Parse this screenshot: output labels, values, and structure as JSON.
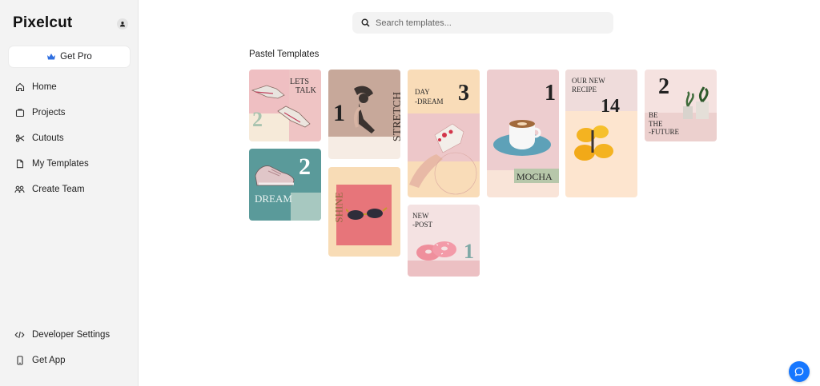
{
  "app": {
    "name": "Pixelcut"
  },
  "sidebar": {
    "get_pro": "Get Pro",
    "items": [
      {
        "label": "Home",
        "icon": "home-icon"
      },
      {
        "label": "Projects",
        "icon": "folder-icon"
      },
      {
        "label": "Cutouts",
        "icon": "scissors-icon"
      },
      {
        "label": "My Templates",
        "icon": "document-icon"
      },
      {
        "label": "Create Team",
        "icon": "team-icon"
      }
    ],
    "bottom_items": [
      {
        "label": "Developer Settings",
        "icon": "code-icon"
      },
      {
        "label": "Get App",
        "icon": "phone-icon"
      }
    ]
  },
  "search": {
    "placeholder": "Search templates..."
  },
  "section": {
    "title": "Pastel Templates"
  },
  "templates": {
    "t1": {
      "title": "LETS",
      "title2": "TALK",
      "number": "2"
    },
    "t2": {
      "number": "2",
      "title": "DREAM"
    },
    "t3": {
      "number": "1",
      "title": "STRETCH"
    },
    "t4": {
      "title": "SHINE"
    },
    "t5": {
      "title": "DAY",
      "title2": "-DREAM",
      "number": "3"
    },
    "t6": {
      "title": "NEW",
      "title2": "-POST",
      "number": "1"
    },
    "t7": {
      "number": "1",
      "title": "MOCHA"
    },
    "t8": {
      "title": "OUR NEW",
      "title2": "RECIPE",
      "number": "14"
    },
    "t9": {
      "number": "2",
      "title": "BE",
      "title2": "THE",
      "title3": "-FUTURE"
    }
  },
  "colors": {
    "accent": "#1677ff",
    "crown": "#2f6fe0"
  }
}
